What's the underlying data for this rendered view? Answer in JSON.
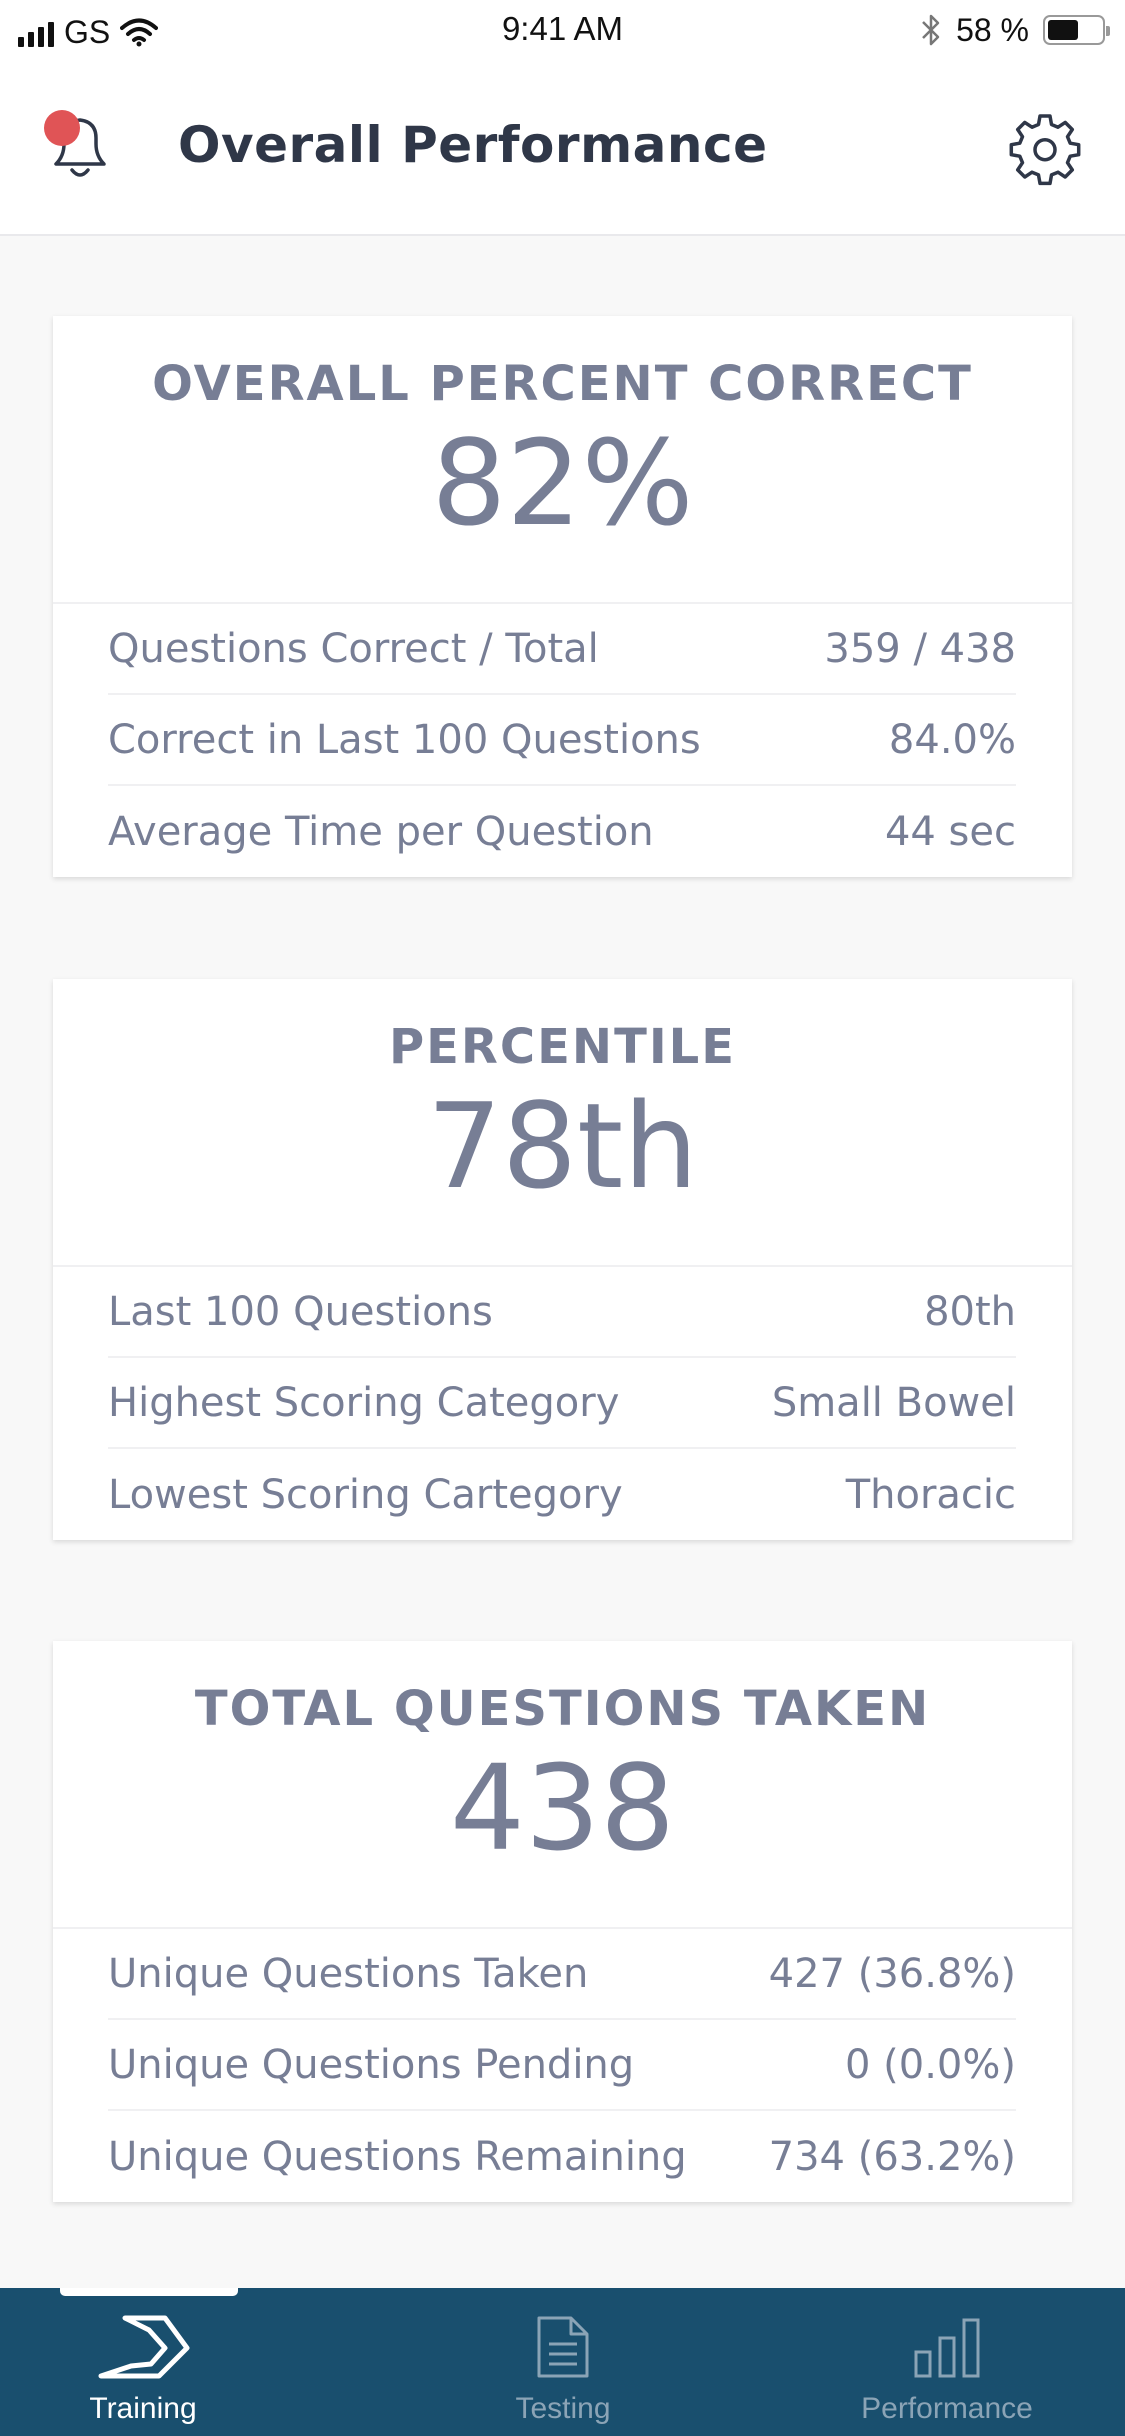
{
  "status_bar": {
    "carrier": "GS",
    "time": "9:41 AM",
    "battery_percent": "58 %",
    "battery_level": 0.58,
    "icons": [
      "signal-icon",
      "wifi-icon",
      "bluetooth-icon",
      "battery-icon"
    ]
  },
  "header": {
    "title": "Overall Performance",
    "notification_icon": "bell-icon",
    "settings_icon": "gear-icon",
    "notification_badge_color": "#e05456"
  },
  "cards": [
    {
      "title": "OVERALL PERCENT CORRECT",
      "value": "82%",
      "rows": [
        {
          "label": "Questions Correct / Total",
          "value": "359 / 438"
        },
        {
          "label": "Correct in Last 100 Questions",
          "value": "84.0%"
        },
        {
          "label": "Average Time per Question",
          "value": "44 sec"
        }
      ]
    },
    {
      "title": "PERCENTILE",
      "value": "78th",
      "rows": [
        {
          "label": "Last 100 Questions",
          "value": "80th"
        },
        {
          "label": "Highest Scoring Category",
          "value": "Small Bowel"
        },
        {
          "label": "Lowest Scoring Cartegory",
          "value": "Thoracic"
        }
      ]
    },
    {
      "title": "TOTAL QUESTIONS TAKEN",
      "value": "438",
      "rows": [
        {
          "label": "Unique Questions Taken",
          "value": "427 (36.8%)"
        },
        {
          "label": "Unique Questions Pending",
          "value": "0 (0.0%)"
        },
        {
          "label": "Unique Questions Remaining",
          "value": "734 (63.2%)"
        }
      ]
    }
  ],
  "tab_bar": {
    "tabs": [
      {
        "label": "Training",
        "icon": "chevron-logo-icon",
        "active": true
      },
      {
        "label": "Testing",
        "icon": "document-icon",
        "active": false
      },
      {
        "label": "Performance",
        "icon": "bar-chart-icon",
        "active": false
      }
    ]
  },
  "colors": {
    "primary_text": "#777e95",
    "title_text": "#2f3748",
    "tab_bar_bg": "#194f6e",
    "tab_active": "#ffffff",
    "tab_inactive": "#8ba4b6"
  }
}
